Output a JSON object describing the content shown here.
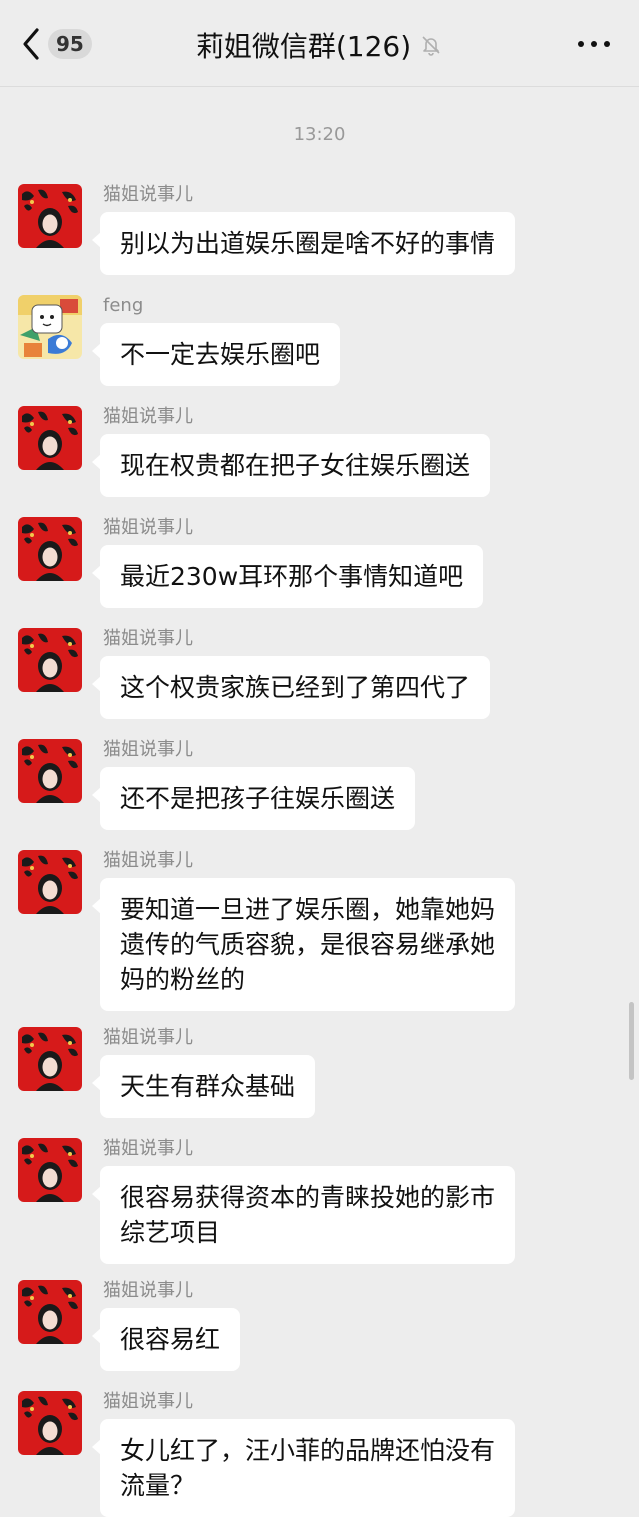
{
  "header": {
    "back_badge": "95",
    "title": "莉姐微信群(126)"
  },
  "timestamp": "13:20",
  "messages": [
    {
      "sender": "猫姐说事儿",
      "avatar": "cat",
      "lines": [
        "别以为出道娱乐圈是啥不好的事情"
      ]
    },
    {
      "sender": "feng",
      "avatar": "feng",
      "lines": [
        "不一定去娱乐圈吧"
      ]
    },
    {
      "sender": "猫姐说事儿",
      "avatar": "cat",
      "lines": [
        "现在权贵都在把子女往娱乐圈送"
      ]
    },
    {
      "sender": "猫姐说事儿",
      "avatar": "cat",
      "lines": [
        "最近230w耳环那个事情知道吧"
      ]
    },
    {
      "sender": "猫姐说事儿",
      "avatar": "cat",
      "lines": [
        "这个权贵家族已经到了第四代了"
      ]
    },
    {
      "sender": "猫姐说事儿",
      "avatar": "cat",
      "lines": [
        "还不是把孩子往娱乐圈送"
      ]
    },
    {
      "sender": "猫姐说事儿",
      "avatar": "cat",
      "lines": [
        "要知道一旦进了娱乐圈，她靠她妈",
        "遗传的气质容貌，是很容易继承她",
        "妈的粉丝的"
      ]
    },
    {
      "sender": "猫姐说事儿",
      "avatar": "cat",
      "lines": [
        "天生有群众基础"
      ]
    },
    {
      "sender": "猫姐说事儿",
      "avatar": "cat",
      "lines": [
        "很容易获得资本的青睐投她的影市",
        "综艺项目"
      ]
    },
    {
      "sender": "猫姐说事儿",
      "avatar": "cat",
      "lines": [
        "很容易红"
      ]
    },
    {
      "sender": "猫姐说事儿",
      "avatar": "cat",
      "lines": [
        "女儿红了，汪小菲的品牌还怕没有",
        "流量？"
      ]
    }
  ]
}
